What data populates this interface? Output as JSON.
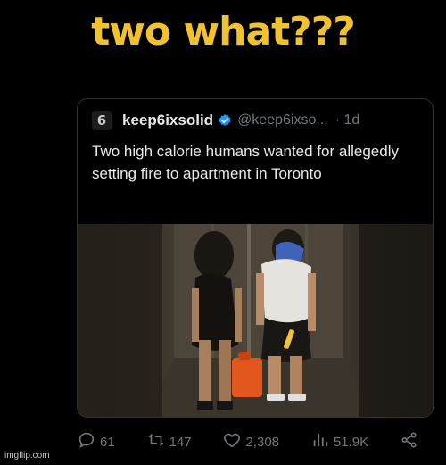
{
  "meme": {
    "caption": "two what???"
  },
  "tweet": {
    "display_name": "keep6ixsolid",
    "handle": "@keep6ixso...",
    "time": "· 1d",
    "avatar_glyph": "6",
    "text": "Two high calorie humans wanted for allegedly setting fire to apartment in Toronto",
    "media": {}
  },
  "actions": {
    "replies": "61",
    "retweets": "147",
    "likes": "2,308",
    "views": "51.9K"
  },
  "watermark": "imgflip.com",
  "colors": {
    "caption": "#f2c12e",
    "verified": "#1d9bf0",
    "muted": "#71767b",
    "text": "#e7e9ea",
    "background": "#000000"
  },
  "icons": [
    "reply-icon",
    "retweet-icon",
    "like-icon",
    "views-icon",
    "share-icon",
    "verified-badge-icon"
  ]
}
